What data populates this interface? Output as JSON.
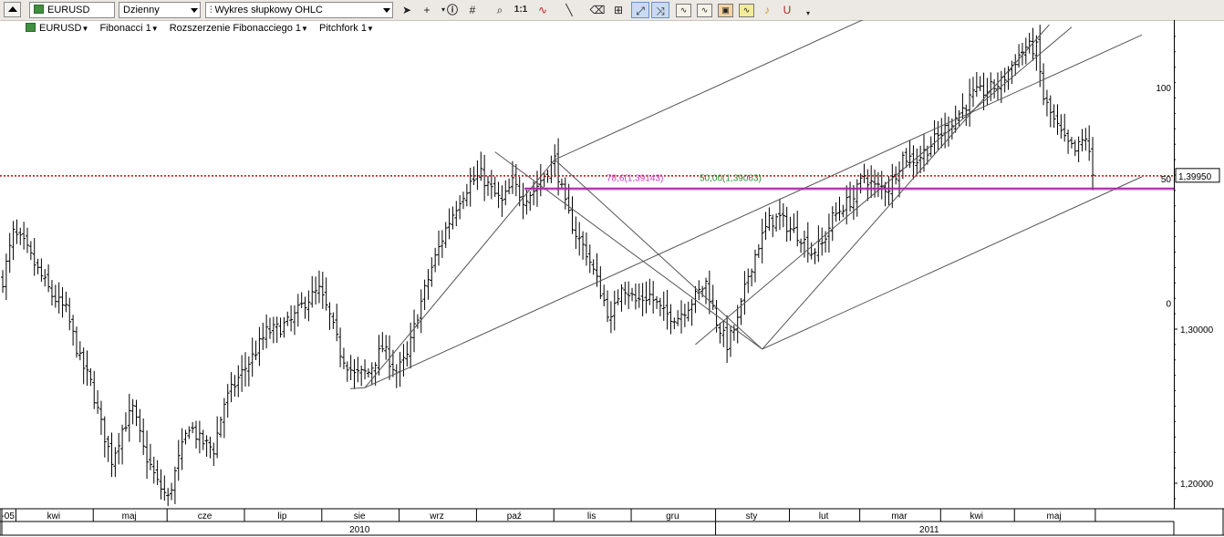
{
  "toolbar": {
    "symbol": "EURUSD",
    "interval": "Dzienny",
    "chart_style": "Wykres słupkowy OHLC",
    "tools": [
      "cursor-icon",
      "crosshair-icon",
      "info-icon",
      "grid-icon",
      "zoom-icon",
      "one-to-one-icon",
      "indicator-icon",
      "line-tool-icon",
      "eraser-icon",
      "objects-icon",
      "trend-tool-icon",
      "fibonacci-tool-icon",
      "template-icon",
      "template-icon",
      "template-icon",
      "wave-icon",
      "alert-bell-icon",
      "magnet-icon",
      "more-icon"
    ],
    "one_to_one_label": "1:1"
  },
  "legend": [
    {
      "label": "EURUSD"
    },
    {
      "label": "Fibonacci 1"
    },
    {
      "label": "Rozszerzenie Fibonacciego 1"
    },
    {
      "label": "Pitchfork 1"
    }
  ],
  "colors": {
    "price_line": "#cc0000",
    "fib_ext": "#cc33cc",
    "fib_ret": "#2e8b2e",
    "fib_line": "#aa22aa",
    "bars": "#000000",
    "drawing": "#555555"
  },
  "chart_data": {
    "type": "ohlc",
    "symbol": "EURUSD",
    "interval": "daily",
    "ylim": [
      1.182,
      1.501
    ],
    "yticks": [
      {
        "value": 1.2,
        "label": "1,20000"
      },
      {
        "value": 1.3,
        "label": "1,30000"
      }
    ],
    "last_price": {
      "value": 1.3995,
      "label": "1,39950"
    },
    "months": [
      {
        "label": "-05",
        "start": 0,
        "end": 4
      },
      {
        "label": "kwi",
        "start": 4,
        "end": 26
      },
      {
        "label": "maj",
        "start": 26,
        "end": 47
      },
      {
        "label": "cze",
        "start": 47,
        "end": 69
      },
      {
        "label": "lip",
        "start": 69,
        "end": 91
      },
      {
        "label": "sie",
        "start": 91,
        "end": 113
      },
      {
        "label": "wrz",
        "start": 113,
        "end": 135
      },
      {
        "label": "paź",
        "start": 135,
        "end": 157
      },
      {
        "label": "lis",
        "start": 157,
        "end": 179
      },
      {
        "label": "gru",
        "start": 179,
        "end": 203
      },
      {
        "label": "sty",
        "start": 203,
        "end": 224
      },
      {
        "label": "lut",
        "start": 224,
        "end": 244
      },
      {
        "label": "mar",
        "start": 244,
        "end": 267
      },
      {
        "label": "kwi",
        "start": 267,
        "end": 288
      },
      {
        "label": "maj",
        "start": 288,
        "end": 311
      },
      {
        "label": "",
        "start": 311,
        "end": 324
      }
    ],
    "years": [
      {
        "label": "2010",
        "start": 0,
        "end": 203
      },
      {
        "label": "2011",
        "start": 203,
        "end": 324
      }
    ],
    "path": [
      [
        0,
        1.332
      ],
      [
        3,
        1.362
      ],
      [
        6,
        1.355
      ],
      [
        10,
        1.338
      ],
      [
        14,
        1.322
      ],
      [
        18,
        1.312
      ],
      [
        22,
        1.28
      ],
      [
        25,
        1.265
      ],
      [
        28,
        1.238
      ],
      [
        31,
        1.215
      ],
      [
        34,
        1.235
      ],
      [
        37,
        1.248
      ],
      [
        40,
        1.222
      ],
      [
        44,
        1.2
      ],
      [
        47,
        1.19
      ],
      [
        50,
        1.215
      ],
      [
        53,
        1.238
      ],
      [
        56,
        1.228
      ],
      [
        60,
        1.222
      ],
      [
        63,
        1.252
      ],
      [
        67,
        1.268
      ],
      [
        71,
        1.282
      ],
      [
        75,
        1.298
      ],
      [
        78,
        1.3
      ],
      [
        82,
        1.305
      ],
      [
        86,
        1.318
      ],
      [
        90,
        1.325
      ],
      [
        93,
        1.308
      ],
      [
        96,
        1.285
      ],
      [
        100,
        1.27
      ],
      [
        104,
        1.272
      ],
      [
        108,
        1.288
      ],
      [
        112,
        1.272
      ],
      [
        115,
        1.282
      ],
      [
        118,
        1.31
      ],
      [
        122,
        1.34
      ],
      [
        126,
        1.365
      ],
      [
        130,
        1.385
      ],
      [
        133,
        1.395
      ],
      [
        136,
        1.4
      ],
      [
        139,
        1.39
      ],
      [
        142,
        1.382
      ],
      [
        145,
        1.395
      ],
      [
        148,
        1.385
      ],
      [
        151,
        1.39
      ],
      [
        154,
        1.4
      ],
      [
        157,
        1.41
      ],
      [
        160,
        1.38
      ],
      [
        163,
        1.362
      ],
      [
        166,
        1.35
      ],
      [
        170,
        1.325
      ],
      [
        173,
        1.305
      ],
      [
        176,
        1.33
      ],
      [
        180,
        1.318
      ],
      [
        184,
        1.322
      ],
      [
        188,
        1.31
      ],
      [
        192,
        1.308
      ],
      [
        196,
        1.318
      ],
      [
        200,
        1.33
      ],
      [
        203,
        1.305
      ],
      [
        206,
        1.29
      ],
      [
        209,
        1.305
      ],
      [
        212,
        1.335
      ],
      [
        215,
        1.355
      ],
      [
        218,
        1.37
      ],
      [
        221,
        1.372
      ],
      [
        224,
        1.365
      ],
      [
        227,
        1.36
      ],
      [
        230,
        1.35
      ],
      [
        233,
        1.355
      ],
      [
        236,
        1.372
      ],
      [
        239,
        1.38
      ],
      [
        242,
        1.385
      ],
      [
        245,
        1.4
      ],
      [
        248,
        1.392
      ],
      [
        252,
        1.392
      ],
      [
        256,
        1.412
      ],
      [
        260,
        1.41
      ],
      [
        264,
        1.42
      ],
      [
        268,
        1.43
      ],
      [
        272,
        1.44
      ],
      [
        276,
        1.452
      ],
      [
        280,
        1.455
      ],
      [
        284,
        1.46
      ],
      [
        288,
        1.475
      ],
      [
        291,
        1.483
      ],
      [
        294,
        1.482
      ],
      [
        296,
        1.45
      ],
      [
        299,
        1.435
      ],
      [
        302,
        1.422
      ],
      [
        305,
        1.415
      ],
      [
        308,
        1.425
      ],
      [
        310,
        1.4
      ]
    ],
    "pitchforks": [
      {
        "p0": [
          103,
          1.262
        ],
        "p1": [
          157,
          1.41
        ],
        "p2": [
          216,
          1.287
        ],
        "extend_to": 324
      },
      {
        "p0": [
          197,
          1.29
        ],
        "p1": [
          304,
          1.496
        ],
        "p2": [
          294,
          1.481
        ]
      }
    ],
    "fibonacci": {
      "extension": {
        "label": "78,6(1,39143)",
        "value": 1.39143
      },
      "retracement": {
        "label": "50,00(1,39063)",
        "value": 1.39063
      },
      "level_labels": [
        {
          "label": "100",
          "value": 1.452
        },
        {
          "label": "50",
          "value": 1.393
        },
        {
          "label": "0",
          "value": 1.312
        }
      ]
    },
    "grid": false,
    "legend": "top-left"
  }
}
